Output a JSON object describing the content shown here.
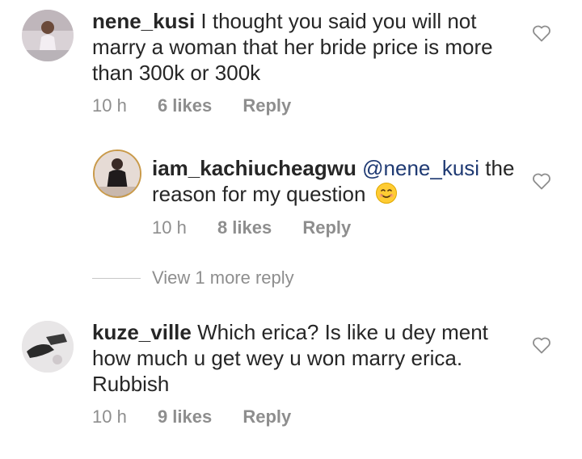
{
  "comments": [
    {
      "username": "nene_kusi",
      "text": " I thought you said you will not marry a woman that her bride price is more than 300k or 300k",
      "time": "10 h",
      "likes": "6 likes",
      "reply_label": "Reply"
    },
    {
      "username": "iam_kachiucheagwu",
      "mention": "@nene_kusi",
      "text": " the reason for my question",
      "emoji": "smiling-face-icon",
      "time": "10 h",
      "likes": "8 likes",
      "reply_label": "Reply"
    },
    {
      "username": "kuze_ville",
      "text": " Which erica? Is like u dey ment how much u get wey u won marry erica. Rubbish",
      "time": "10 h",
      "likes": "9 likes",
      "reply_label": "Reply"
    }
  ],
  "view_more_replies": "View 1 more reply",
  "colors": {
    "text": "#262626",
    "meta": "#8e8e8e",
    "mention": "#1f3a73",
    "background": "#ffffff"
  },
  "icons": [
    "heart-outline-icon",
    "smiling-face-icon"
  ]
}
